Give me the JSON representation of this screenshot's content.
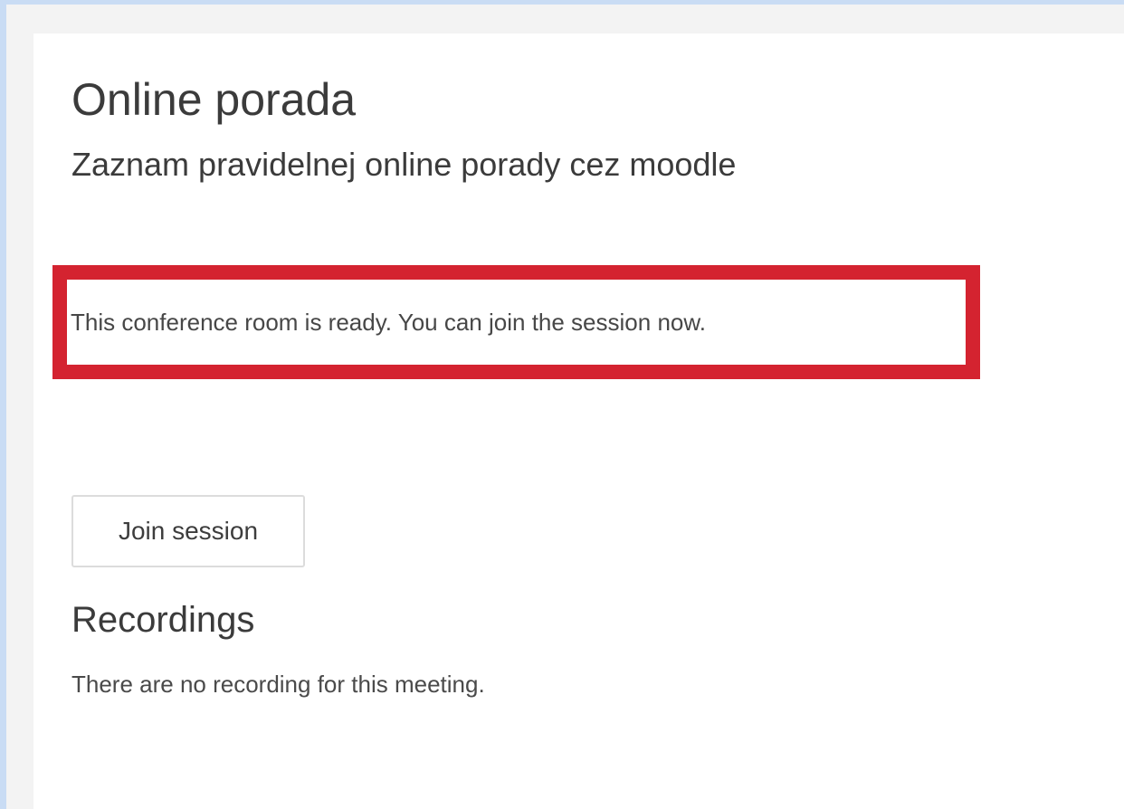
{
  "activity": {
    "title": "Online porada",
    "description": "Zaznam pravidelnej online porady cez moodle"
  },
  "status": {
    "message": "This conference room is ready. You can join the session now.",
    "highlight_color": "#d42330"
  },
  "actions": {
    "join_label": "Join session"
  },
  "recordings": {
    "heading": "Recordings",
    "empty_message": "There are no recording for this meeting."
  }
}
